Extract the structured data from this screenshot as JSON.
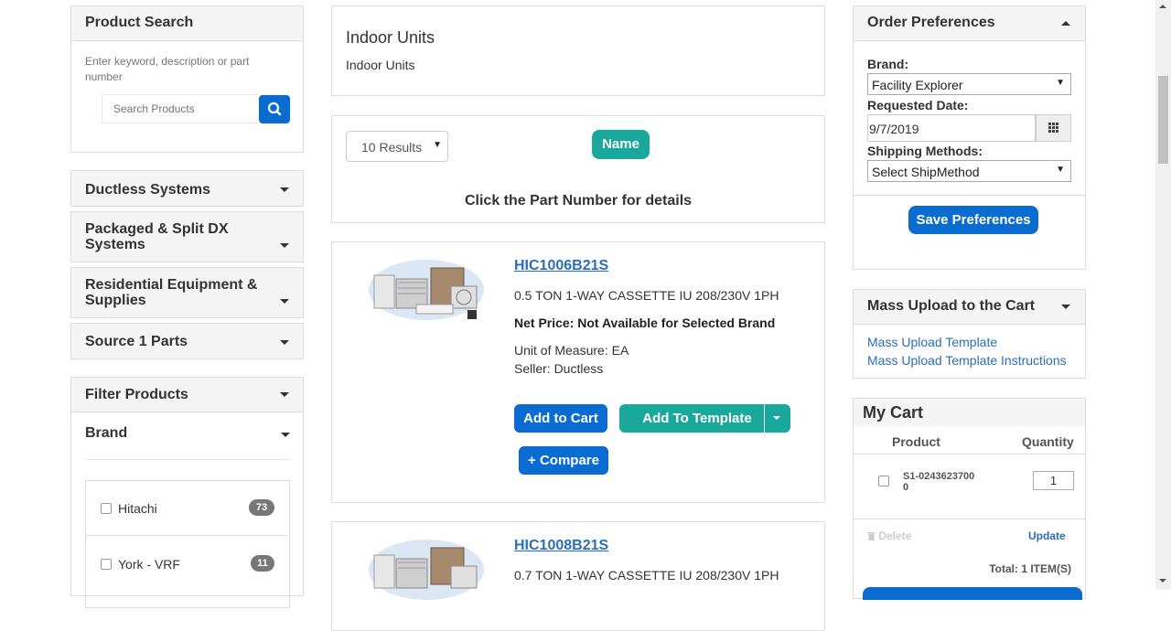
{
  "product_search": {
    "title": "Product Search",
    "hint": "Enter keyword, description or part number",
    "placeholder": "Search Products"
  },
  "categories": [
    {
      "label": "Ductless Systems"
    },
    {
      "label": "Packaged & Split DX Systems"
    },
    {
      "label": "Residential Equipment & Supplies"
    },
    {
      "label": "Source 1 Parts"
    }
  ],
  "filter": {
    "title": "Filter Products",
    "brand_title": "Brand",
    "brands": [
      {
        "label": "Hitachi",
        "count": "73"
      },
      {
        "label": "York - VRF",
        "count": "11"
      }
    ]
  },
  "category_header": {
    "title": "Indoor Units",
    "subtitle": "Indoor Units"
  },
  "results": {
    "per_page": "10 Results",
    "sort_label": "Name",
    "instructions": "Click the Part Number for details"
  },
  "products": [
    {
      "part_number": "HIC1006B21S",
      "description": "0.5 TON 1-WAY CASSETTE IU 208/230V 1PH",
      "net_price": "Net Price: Not Available for Selected Brand",
      "uom": "Unit of Measure: EA",
      "seller": "Seller: Ductless",
      "add_to_cart": "Add to Cart",
      "add_to_template": "Add To Template",
      "compare": "+ Compare"
    },
    {
      "part_number": "HIC1008B21S",
      "description": "0.7 TON 1-WAY CASSETTE IU 208/230V 1PH"
    }
  ],
  "order_prefs": {
    "title": "Order Preferences",
    "brand_label": "Brand:",
    "brand_value": "Facility Explorer",
    "date_label": "Requested Date:",
    "date_value": "9/7/2019",
    "ship_label": "Shipping Methods:",
    "ship_value": "Select ShipMethod",
    "save": "Save Preferences"
  },
  "mass_upload": {
    "title": "Mass Upload to the Cart",
    "link1": "Mass Upload Template",
    "link2": "Mass Upload Template Instructions"
  },
  "cart": {
    "title": "My Cart",
    "col_product": "Product",
    "col_quantity": "Quantity",
    "item_product": "S1-02436237000",
    "item_qty": "1",
    "delete": "Delete",
    "update": "Update",
    "total": "Total: 1 ITEM(S)"
  },
  "colors": {
    "primary_blue": "#0a6bd1",
    "teal": "#19a89b",
    "link": "#2a6ebb"
  }
}
